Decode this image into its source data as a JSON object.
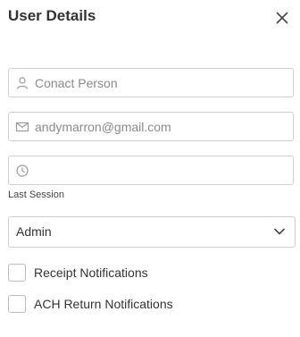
{
  "header": {
    "title": "User Details"
  },
  "form": {
    "contact_person": {
      "placeholder": "Conact Person",
      "icon": "person-icon"
    },
    "email": {
      "value": "andymarron@gmail.com",
      "icon": "mail-icon"
    },
    "last_session": {
      "value": "",
      "label": "Last Session",
      "icon": "clock-icon"
    },
    "role": {
      "selected": "Admin",
      "icon": "chevron-down-icon"
    },
    "checkboxes": [
      {
        "label": "Receipt Notifications",
        "checked": false
      },
      {
        "label": "ACH Return Notifications",
        "checked": false
      }
    ]
  },
  "colors": {
    "border": "#cfcfcf",
    "text": "#333333",
    "placeholder": "#8a8a8a"
  }
}
